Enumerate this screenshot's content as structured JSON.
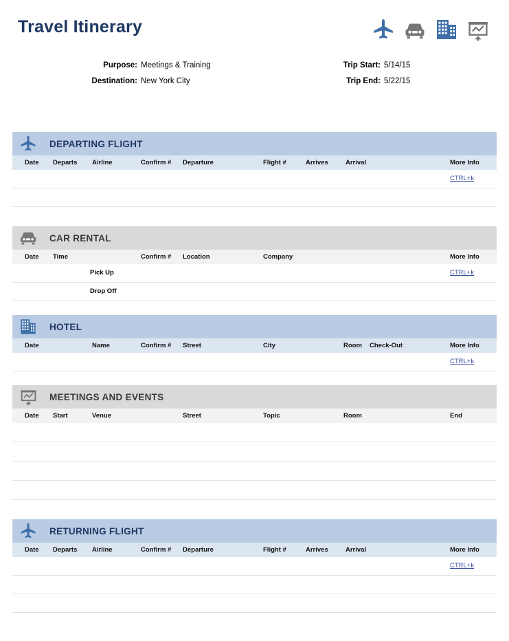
{
  "document": {
    "title": "Travel Itinerary",
    "header_icons": [
      "airplane-icon",
      "car-icon",
      "building-icon",
      "presentation-chart-icon"
    ],
    "colors": {
      "title": "#1f3864",
      "band_blue": "#b9cce4",
      "band_gray": "#d9d9d9",
      "colhead_blue": "#dce6f1",
      "colhead_gray": "#f2f2f2",
      "link": "#3b4fa0",
      "icon_blue": "#3f6fa8",
      "icon_gray": "#767676"
    }
  },
  "meta": {
    "purpose_label": "Purpose:",
    "purpose_value": "Meetings & Training",
    "destination_label": "Destination:",
    "destination_value": "New York City",
    "trip_start_label": "Trip Start:",
    "trip_start_value": "5/14/15",
    "trip_end_label": "Trip End:",
    "trip_end_value": "5/22/15"
  },
  "sections": {
    "departing_flight": {
      "title": "DEPARTING FLIGHT",
      "icon": "airplane-icon",
      "columns": [
        "Date",
        "Departs",
        "Airline",
        "Confirm #",
        "Departure",
        "Flight #",
        "Arrives",
        "Arrival",
        "More Info"
      ],
      "rows": [
        {
          "more_info": "CTRL+k"
        },
        {
          "more_info": ""
        }
      ]
    },
    "car_rental": {
      "title": "CAR RENTAL",
      "icon": "car-icon",
      "columns": [
        "Date",
        "Time",
        "Confirm #",
        "Location",
        "Company",
        "More Info"
      ],
      "rows": [
        {
          "time": "Pick Up",
          "more_info": "CTRL+k"
        },
        {
          "time": "Drop Off",
          "more_info": ""
        }
      ]
    },
    "hotel": {
      "title": "HOTEL",
      "icon": "building-icon",
      "columns": [
        "Date",
        "Name",
        "Confirm #",
        "Street",
        "City",
        "Room",
        "Check-Out",
        "More Info"
      ],
      "rows": [
        {
          "more_info": "CTRL+k"
        }
      ]
    },
    "meetings_and_events": {
      "title": "MEETINGS AND EVENTS",
      "icon": "presentation-chart-icon",
      "columns": [
        "Date",
        "Start",
        "Venue",
        "Street",
        "Topic",
        "Room",
        "End"
      ],
      "rows": [
        {
          "more_info": ""
        },
        {
          "more_info": ""
        },
        {
          "more_info": ""
        },
        {
          "more_info": ""
        }
      ]
    },
    "returning_flight": {
      "title": "RETURNING FLIGHT",
      "icon": "airplane-icon",
      "columns": [
        "Date",
        "Departs",
        "Airline",
        "Confirm #",
        "Departure",
        "Flight #",
        "Arrives",
        "Arrival",
        "More Info"
      ],
      "rows": [
        {
          "more_info": "CTRL+k"
        },
        {
          "more_info": ""
        },
        {
          "more_info": ""
        }
      ]
    }
  }
}
